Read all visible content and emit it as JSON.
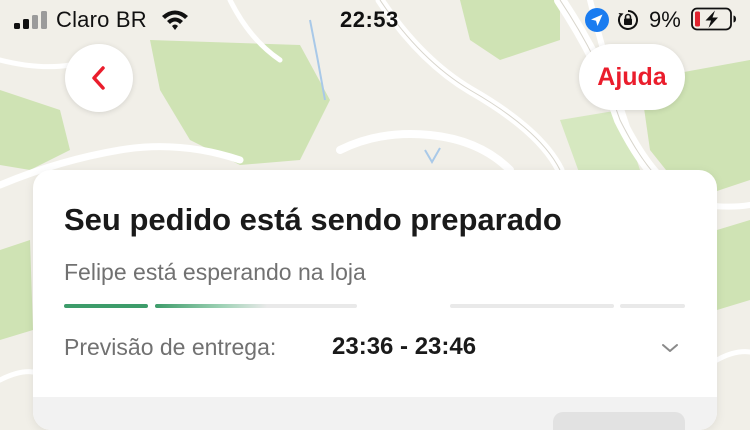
{
  "status_bar": {
    "carrier": "Claro BR",
    "time": "22:53",
    "battery_percent": "9%",
    "signal_bars": 4,
    "signal_bars_active": 2,
    "icons": [
      "signal-bars-icon",
      "wifi-icon",
      "location-arrow-icon",
      "orientation-lock-icon",
      "battery-charging-icon"
    ]
  },
  "map": {
    "back_icon": "chevron-left-icon",
    "help_label": "Ajuda"
  },
  "order_card": {
    "title": "Seu pedido está sendo preparado",
    "subtitle": "Felipe está esperando na loja",
    "progress_steps": [
      {
        "state": "done"
      },
      {
        "state": "in-progress"
      },
      {
        "state": "pending"
      },
      {
        "state": "pending"
      }
    ],
    "eta_label": "Previsão de entrega:",
    "eta_value": "23:36 - 23:46",
    "expand_icon": "chevron-down-icon"
  },
  "colors": {
    "brand_red": "#ea1d2c",
    "progress_green": "#3d9c6a",
    "map_background": "#f1efe8",
    "map_park": "#cfe3b4",
    "map_road": "#ffffff"
  }
}
